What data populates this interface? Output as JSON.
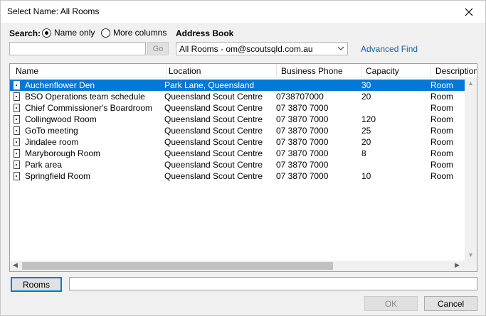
{
  "window": {
    "title": "Select Name: All Rooms"
  },
  "search": {
    "label": "Search:",
    "options": [
      "Name only",
      "More columns"
    ],
    "selected": "Name only",
    "value": "",
    "go_label": "Go"
  },
  "address_book": {
    "label": "Address Book",
    "selected": "All Rooms - om@scoutsqld.com.au",
    "advanced_find": "Advanced Find"
  },
  "table": {
    "columns": [
      "Name",
      "Location",
      "Business Phone",
      "Capacity",
      "Description"
    ],
    "rows": [
      {
        "name": "Auchenflower Den",
        "location": "Park Lane, Queensland",
        "phone": "",
        "capacity": "30",
        "description": "Room",
        "selected": true
      },
      {
        "name": "BSO Operations team schedule",
        "location": "Queensland Scout Centre",
        "phone": "0738707000",
        "capacity": "20",
        "description": "Room"
      },
      {
        "name": "Chief Commissioner's Boardroom",
        "location": "Queensland Scout Centre",
        "phone": "07 3870 7000",
        "capacity": "",
        "description": "Room"
      },
      {
        "name": "Collingwood Room",
        "location": "Queensland Scout Centre",
        "phone": "07 3870 7000",
        "capacity": "120",
        "description": "Room"
      },
      {
        "name": "GoTo meeting",
        "location": "Queensland Scout Centre",
        "phone": "07 3870 7000",
        "capacity": "25",
        "description": "Room"
      },
      {
        "name": "Jindalee room",
        "location": "Queensland Scout Centre",
        "phone": "07 3870 7000",
        "capacity": "20",
        "description": "Room"
      },
      {
        "name": "Maryborough Room",
        "location": "Queensland Scout Centre",
        "phone": "07 3870 7000",
        "capacity": "8",
        "description": "Room"
      },
      {
        "name": "Park area",
        "location": "Queensland Scout Centre",
        "phone": "07 3870 7000",
        "capacity": "",
        "description": "Room"
      },
      {
        "name": "Springfield Room",
        "location": "Queensland Scout Centre",
        "phone": "07 3870 7000",
        "capacity": "10",
        "description": "Room"
      }
    ]
  },
  "footer": {
    "rooms_button": "Rooms",
    "rooms_value": "",
    "ok": "OK",
    "cancel": "Cancel"
  },
  "colors": {
    "selection": "#0078d7",
    "link": "#1c5fa8"
  },
  "icons": [
    "close-icon",
    "chevron-down-icon",
    "room-icon",
    "scroll-up-arrow-icon",
    "scroll-down-arrow-icon",
    "scroll-left-arrow-icon",
    "scroll-right-arrow-icon"
  ]
}
